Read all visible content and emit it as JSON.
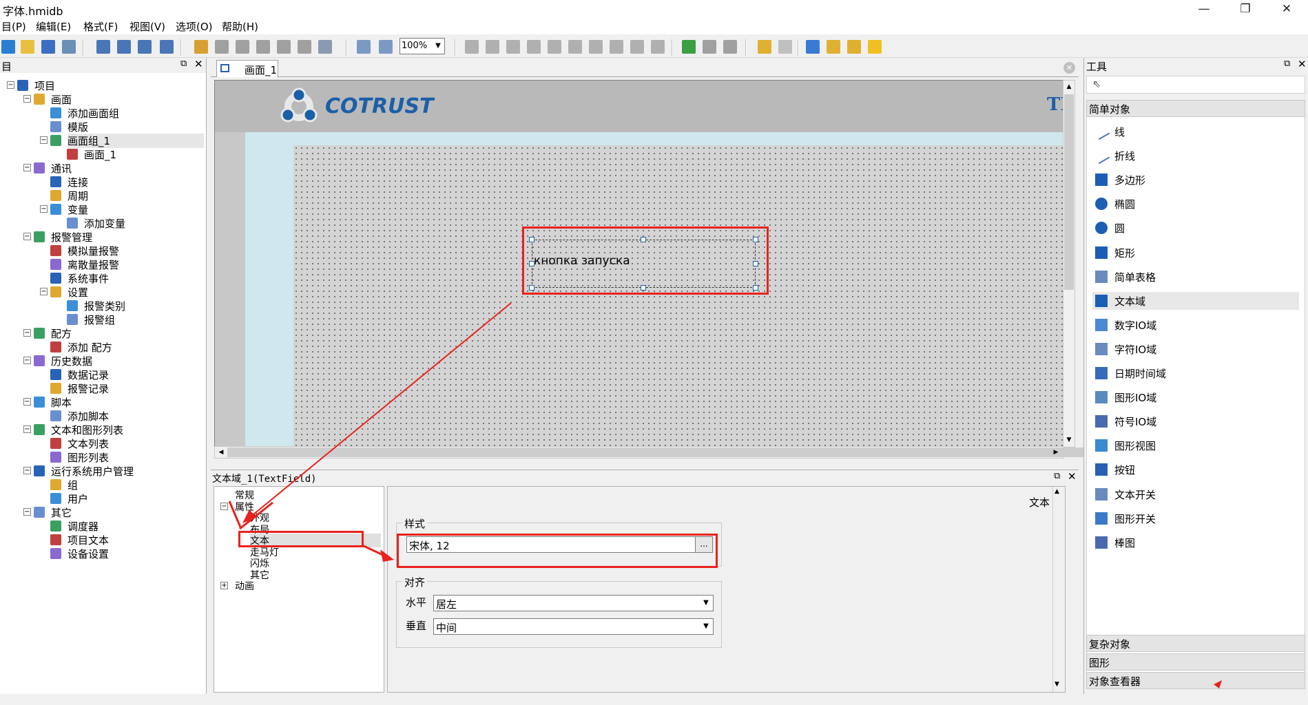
{
  "window": {
    "title": "字体.hmidb",
    "minimize": "—",
    "restore": "❐",
    "close": "✕"
  },
  "menu": [
    "目(P)",
    "编辑(E)",
    "格式(F)",
    "视图(V)",
    "选项(O)",
    "帮助(H)"
  ],
  "toolbar": {
    "zoom": "100%"
  },
  "left_panel": {
    "title": "目",
    "tree": [
      {
        "label": "项目",
        "level": 0,
        "icon": "project-icon",
        "exp": "-"
      },
      {
        "label": "画面",
        "level": 1,
        "icon": "screen-folder-icon",
        "exp": "-"
      },
      {
        "label": "添加画面组",
        "level": 2,
        "icon": "add-screen-group-icon"
      },
      {
        "label": "模版",
        "level": 2,
        "icon": "template-icon"
      },
      {
        "label": "画面组_1",
        "level": 2,
        "icon": "screen-group-icon",
        "exp": "-",
        "selected": true
      },
      {
        "label": "画面_1",
        "level": 3,
        "icon": "screen-icon"
      },
      {
        "label": "通讯",
        "level": 1,
        "icon": "communication-icon",
        "exp": "-"
      },
      {
        "label": "连接",
        "level": 2,
        "icon": "connection-icon"
      },
      {
        "label": "周期",
        "level": 2,
        "icon": "cycle-icon"
      },
      {
        "label": "变量",
        "level": 2,
        "icon": "variable-icon",
        "exp": "-"
      },
      {
        "label": "添加变量",
        "level": 3,
        "icon": "add-variable-icon"
      },
      {
        "label": "报警管理",
        "level": 1,
        "icon": "alarm-icon",
        "exp": "-"
      },
      {
        "label": "模拟量报警",
        "level": 2,
        "icon": "analog-alarm-icon"
      },
      {
        "label": "离散量报警",
        "level": 2,
        "icon": "discrete-alarm-icon"
      },
      {
        "label": "系统事件",
        "level": 2,
        "icon": "system-event-icon"
      },
      {
        "label": "设置",
        "level": 2,
        "icon": "settings-icon",
        "exp": "-"
      },
      {
        "label": "报警类别",
        "level": 3,
        "icon": "alarm-class-icon"
      },
      {
        "label": "报警组",
        "level": 3,
        "icon": "alarm-group-icon"
      },
      {
        "label": "配方",
        "level": 1,
        "icon": "recipe-icon",
        "exp": "-"
      },
      {
        "label": "添加 配方",
        "level": 2,
        "icon": "add-recipe-icon"
      },
      {
        "label": "历史数据",
        "level": 1,
        "icon": "history-icon",
        "exp": "-"
      },
      {
        "label": "数据记录",
        "level": 2,
        "icon": "data-log-icon"
      },
      {
        "label": "报警记录",
        "level": 2,
        "icon": "alarm-log-icon"
      },
      {
        "label": "脚本",
        "level": 1,
        "icon": "script-icon",
        "exp": "-"
      },
      {
        "label": "添加脚本",
        "level": 2,
        "icon": "add-script-icon"
      },
      {
        "label": "文本和图形列表",
        "level": 1,
        "icon": "text-graphic-list-icon",
        "exp": "-"
      },
      {
        "label": "文本列表",
        "level": 2,
        "icon": "text-list-icon"
      },
      {
        "label": "图形列表",
        "level": 2,
        "icon": "graphic-list-icon"
      },
      {
        "label": "运行系统用户管理",
        "level": 1,
        "icon": "user-management-icon",
        "exp": "-"
      },
      {
        "label": "组",
        "level": 2,
        "icon": "group-icon"
      },
      {
        "label": "用户",
        "level": 2,
        "icon": "user-icon"
      },
      {
        "label": "其它",
        "level": 1,
        "icon": "other-icon",
        "exp": "-"
      },
      {
        "label": "调度器",
        "level": 2,
        "icon": "scheduler-icon"
      },
      {
        "label": "项目文本",
        "level": 2,
        "icon": "project-text-icon"
      },
      {
        "label": "设备设置",
        "level": 2,
        "icon": "device-settings-icon"
      }
    ]
  },
  "editor": {
    "tab": "画面_1",
    "logo": "COTRUST",
    "header_right_text": "TI",
    "textfield_text": "кнопка  запуска"
  },
  "properties": {
    "title": "文本域_1(TextField)",
    "tree": [
      {
        "label": "常规",
        "indent": 1,
        "exp": ""
      },
      {
        "label": "属性",
        "indent": 1,
        "exp": "-"
      },
      {
        "label": "外观",
        "indent": 2
      },
      {
        "label": "布局",
        "indent": 2
      },
      {
        "label": "文本",
        "indent": 2,
        "selected": true
      },
      {
        "label": "走马灯",
        "indent": 2
      },
      {
        "label": "闪烁",
        "indent": 2
      },
      {
        "label": "其它",
        "indent": 2
      },
      {
        "label": "动画",
        "indent": 1,
        "exp": "+"
      }
    ],
    "section_title": "文本",
    "style_group": "样式",
    "font_value": "宋体, 12",
    "browse_button": "...",
    "align_group": "对齐",
    "h_label": "水平",
    "h_value": "居左",
    "v_label": "垂直",
    "v_value": "中间"
  },
  "tools": {
    "title": "工具",
    "simple_objects": "简单对象",
    "items": [
      {
        "label": "线",
        "icon": "line-icon"
      },
      {
        "label": "折线",
        "icon": "polyline-icon"
      },
      {
        "label": "多边形",
        "icon": "polygon-icon"
      },
      {
        "label": "椭圆",
        "icon": "ellipse-icon"
      },
      {
        "label": "圆",
        "icon": "circle-icon"
      },
      {
        "label": "矩形",
        "icon": "rectangle-icon"
      },
      {
        "label": "简单表格",
        "icon": "table-icon"
      },
      {
        "label": "文本域",
        "icon": "text-field-icon",
        "selected": true
      },
      {
        "label": "数字IO域",
        "icon": "numeric-io-icon"
      },
      {
        "label": "字符IO域",
        "icon": "char-io-icon"
      },
      {
        "label": "日期时间域",
        "icon": "datetime-icon"
      },
      {
        "label": "图形IO域",
        "icon": "graphic-io-icon"
      },
      {
        "label": "符号IO域",
        "icon": "symbol-io-icon"
      },
      {
        "label": "图形视图",
        "icon": "graphic-view-icon"
      },
      {
        "label": "按钮",
        "icon": "button-icon"
      },
      {
        "label": "文本开关",
        "icon": "text-switch-icon"
      },
      {
        "label": "图形开关",
        "icon": "graphic-switch-icon"
      },
      {
        "label": "棒图",
        "icon": "bar-graph-icon"
      }
    ],
    "sections": [
      "复杂对象",
      "图形",
      "对象查看器"
    ]
  },
  "colors": {
    "annotation": "#e8221c",
    "selection": "#1a5fb4",
    "logo": "#1b5fa8"
  }
}
